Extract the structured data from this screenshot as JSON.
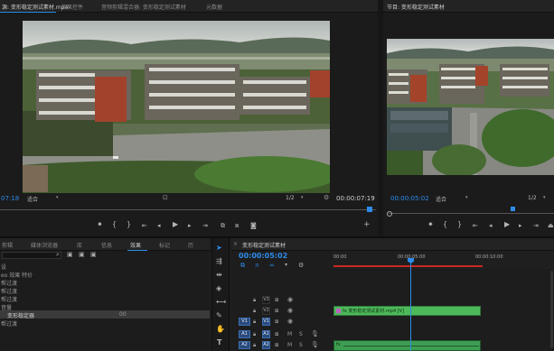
{
  "source_monitor": {
    "tabs": [
      {
        "label": "源: 变形稳定测试素材.mp4",
        "active": true
      },
      {
        "label": "效果控件",
        "active": false
      },
      {
        "label": "音频剪辑混合器: 变形稳定测试素材",
        "active": false
      },
      {
        "label": "元数据",
        "active": false
      }
    ],
    "timecode_left": "07:18",
    "fit_label": "适合",
    "fraction": "1/2",
    "timecode_right": "00:00:07:19"
  },
  "program_monitor": {
    "title": "节目: 变形稳定测试素材",
    "timecode_left": "00:00:05:02",
    "fit_label": "适合",
    "fraction": "1/2"
  },
  "project_panel": {
    "tabs": [
      {
        "label": "剪辑",
        "active": false
      },
      {
        "label": "媒体浏览器",
        "active": false
      },
      {
        "label": "库",
        "active": false
      },
      {
        "label": "信息",
        "active": false
      },
      {
        "label": "效果",
        "active": true
      },
      {
        "label": "标记",
        "active": false
      },
      {
        "label": "历",
        "active": false
      }
    ],
    "items": [
      {
        "label": "设",
        "selected": false
      },
      {
        "label": "eo 效果 特价",
        "selected": false
      },
      {
        "label": "帮过渡",
        "selected": false
      },
      {
        "label": "帮过渡",
        "selected": false
      },
      {
        "label": "帮过渡",
        "selected": false
      },
      {
        "label": "音量",
        "selected": false
      },
      {
        "label": "变形稳定器",
        "selected": true,
        "value": "00"
      },
      {
        "label": "帮过渡",
        "selected": false
      }
    ]
  },
  "timeline": {
    "title": "变形稳定测试素材",
    "timecode": "00:00:05:02",
    "ruler": [
      "00:00",
      "00:00:05:00",
      "00:00:10:00"
    ],
    "tracks": [
      {
        "name": "V3",
        "src": ""
      },
      {
        "name": "V2",
        "src": ""
      },
      {
        "name": "V1",
        "src": "V1"
      },
      {
        "name": "A1",
        "src": "A1"
      },
      {
        "name": "A2",
        "src": "A2"
      }
    ],
    "video_clip_label": "fx 变形稳定测试素材.mp4 [V]",
    "audio_clip_label": "fx"
  },
  "colors": {
    "accent": "#2d8ceb",
    "video_clip": "#4db85a",
    "audio_clip": "#3d9e52",
    "work_area": "#c8291f",
    "selected_row": "#3b3b3b"
  },
  "icons": {
    "selection_tool": "cursor-arrow",
    "ripple_tool": "ripple-edit",
    "razor_tool": "razor-blade",
    "slip_tool": "slip",
    "pen_tool": "pen",
    "hand_tool": "hand",
    "type_tool": "text-T"
  }
}
